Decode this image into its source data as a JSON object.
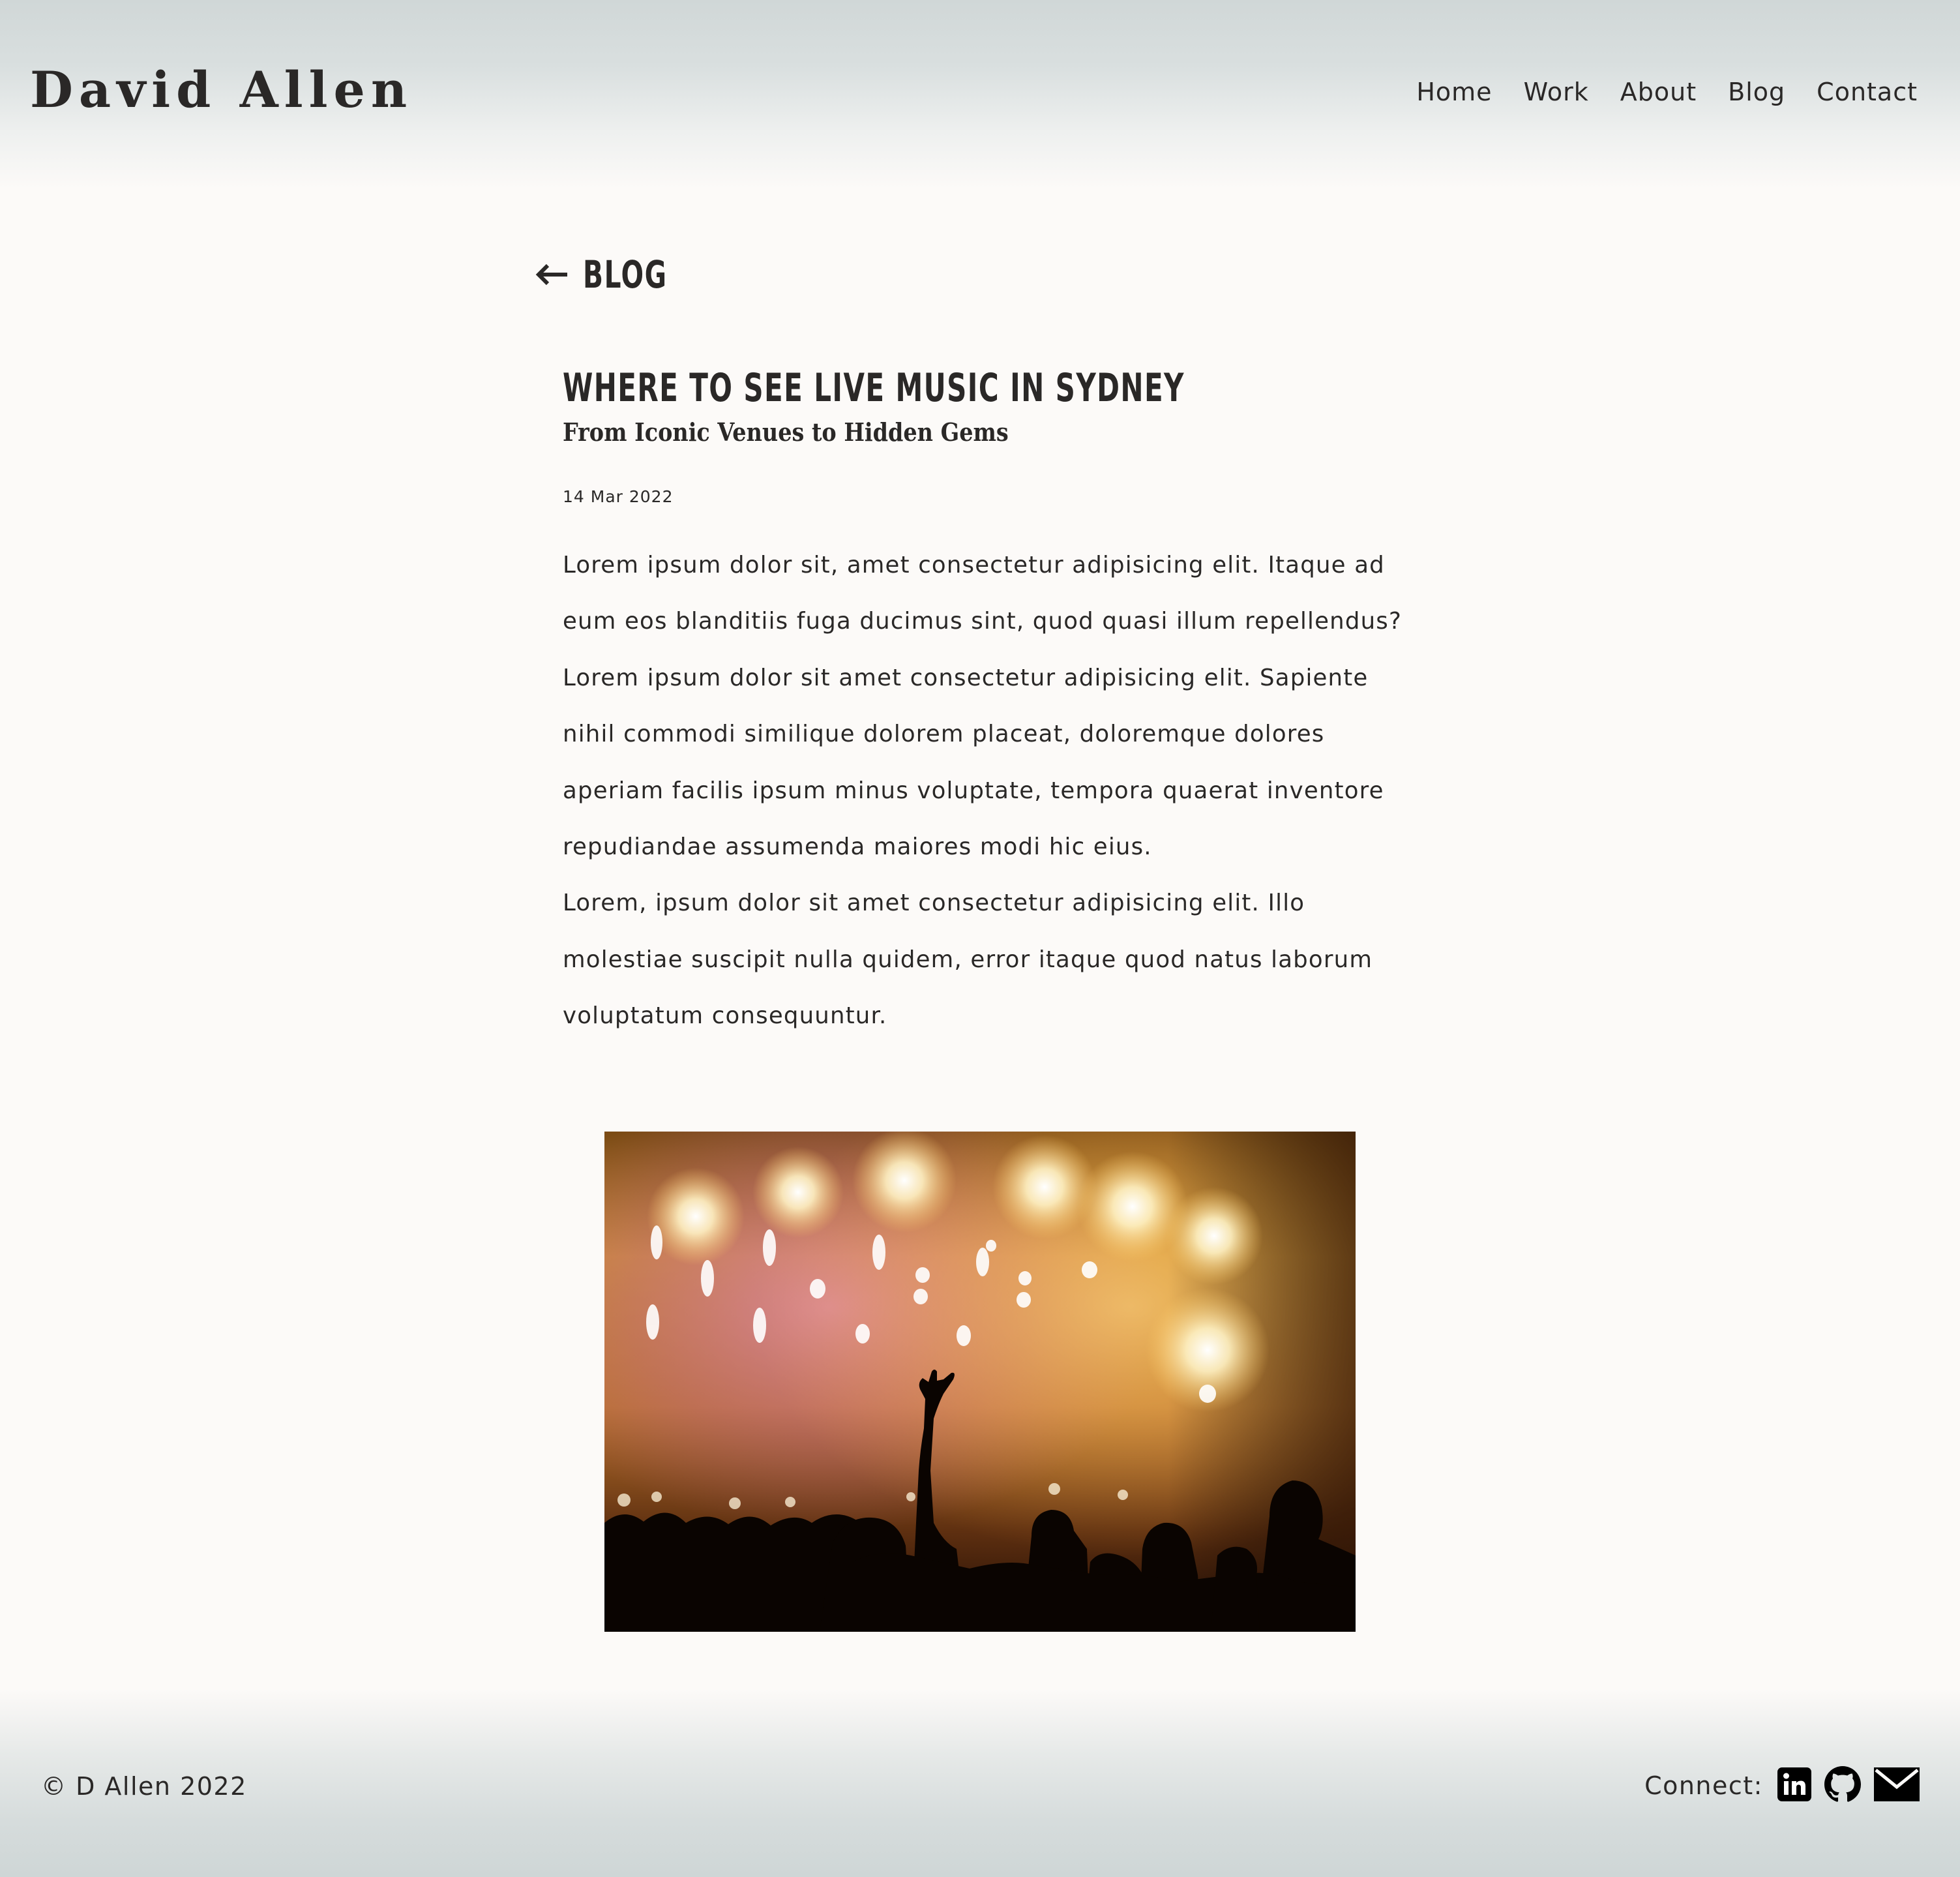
{
  "header": {
    "site_title": "David Allen",
    "nav": [
      "Home",
      "Work",
      "About",
      "Blog",
      "Contact"
    ]
  },
  "back_link": {
    "icon": "arrow-left-icon",
    "label": "BLOG"
  },
  "post": {
    "title": "WHERE TO SEE LIVE MUSIC IN SYDNEY",
    "subtitle": "From Iconic Venues to Hidden Gems",
    "date": "14 Mar 2022",
    "paragraphs": [
      "Lorem ipsum dolor sit, amet consectetur adipisicing elit. Itaque ad eum eos blanditiis fuga ducimus sint, quod quasi illum repellendus?",
      "Lorem ipsum dolor sit amet consectetur adipisicing elit. Sapiente nihil commodi similique dolorem placeat, doloremque dolores aperiam facilis ipsum minus voluptate, tempora quaerat inventore repudiandae assumenda maiores modi hic eius.",
      "Lorem, ipsum dolor sit amet consectetur adipisicing elit. Illo molestiae suscipit nulla quidem, error itaque quod natus laborum voluptatum consequuntur."
    ],
    "image": {
      "subject": "concert crowd silhouettes with raised hand under warm stage lights"
    }
  },
  "footer": {
    "copyright": "© D Allen 2022",
    "connect_label": "Connect:",
    "social_icons": [
      "linkedin-icon",
      "github-icon",
      "mail-icon"
    ]
  },
  "colors": {
    "page_background": "#fcfaf8",
    "header_footer_tint": "#d0d7d7",
    "text": "#2a2827"
  }
}
